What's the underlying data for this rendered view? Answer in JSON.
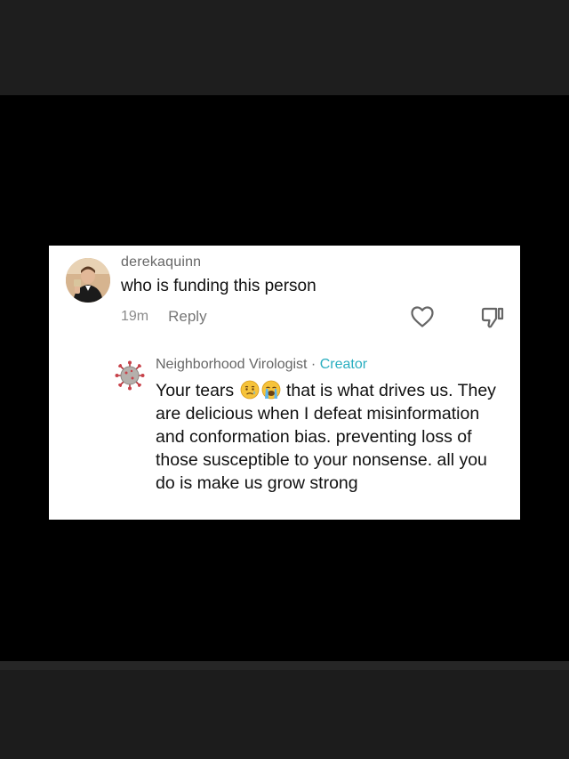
{
  "comment": {
    "username": "derekaquinn",
    "text": "who is funding this person",
    "time": "19m",
    "reply_label": "Reply"
  },
  "reply": {
    "username": "Neighborhood Virologist",
    "separator": " · ",
    "badge": "Creator",
    "text_lead": "Your tears ",
    "text_rest": " that is what drives us. They are delicious when I defeat misinformation and conformation bias. preventing loss of those susceptible to your nonsense. all you do is make us grow strong",
    "emojis": [
      "sad-relieved-face-emoji",
      "loudly-crying-face-emoji"
    ]
  },
  "colors": {
    "creator_badge": "#2aaec0",
    "card_background": "#ffffff",
    "page_background": "#000000"
  },
  "icons": {
    "like": "heart-outline-icon",
    "dislike": "thumbs-down-outline-icon"
  }
}
